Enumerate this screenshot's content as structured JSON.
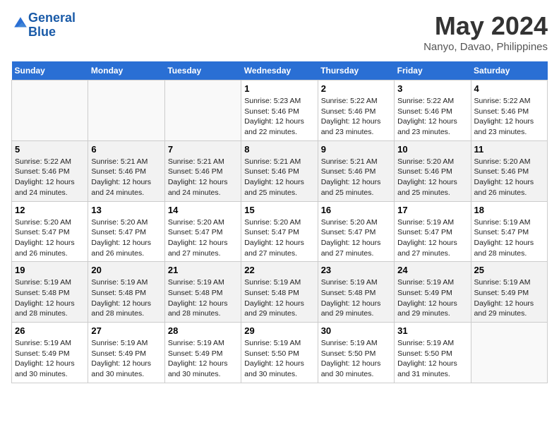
{
  "logo": {
    "line1": "General",
    "line2": "Blue",
    "alt": "GeneralBlue logo"
  },
  "title": "May 2024",
  "subtitle": "Nanyo, Davao, Philippines",
  "header": {
    "days": [
      "Sunday",
      "Monday",
      "Tuesday",
      "Wednesday",
      "Thursday",
      "Friday",
      "Saturday"
    ]
  },
  "weeks": [
    {
      "cells": [
        {
          "date": "",
          "info": ""
        },
        {
          "date": "",
          "info": ""
        },
        {
          "date": "",
          "info": ""
        },
        {
          "date": "1",
          "info": "Sunrise: 5:23 AM\nSunset: 5:46 PM\nDaylight: 12 hours\nand 22 minutes."
        },
        {
          "date": "2",
          "info": "Sunrise: 5:22 AM\nSunset: 5:46 PM\nDaylight: 12 hours\nand 23 minutes."
        },
        {
          "date": "3",
          "info": "Sunrise: 5:22 AM\nSunset: 5:46 PM\nDaylight: 12 hours\nand 23 minutes."
        },
        {
          "date": "4",
          "info": "Sunrise: 5:22 AM\nSunset: 5:46 PM\nDaylight: 12 hours\nand 23 minutes."
        }
      ]
    },
    {
      "cells": [
        {
          "date": "5",
          "info": "Sunrise: 5:22 AM\nSunset: 5:46 PM\nDaylight: 12 hours\nand 24 minutes."
        },
        {
          "date": "6",
          "info": "Sunrise: 5:21 AM\nSunset: 5:46 PM\nDaylight: 12 hours\nand 24 minutes."
        },
        {
          "date": "7",
          "info": "Sunrise: 5:21 AM\nSunset: 5:46 PM\nDaylight: 12 hours\nand 24 minutes."
        },
        {
          "date": "8",
          "info": "Sunrise: 5:21 AM\nSunset: 5:46 PM\nDaylight: 12 hours\nand 25 minutes."
        },
        {
          "date": "9",
          "info": "Sunrise: 5:21 AM\nSunset: 5:46 PM\nDaylight: 12 hours\nand 25 minutes."
        },
        {
          "date": "10",
          "info": "Sunrise: 5:20 AM\nSunset: 5:46 PM\nDaylight: 12 hours\nand 25 minutes."
        },
        {
          "date": "11",
          "info": "Sunrise: 5:20 AM\nSunset: 5:46 PM\nDaylight: 12 hours\nand 26 minutes."
        }
      ]
    },
    {
      "cells": [
        {
          "date": "12",
          "info": "Sunrise: 5:20 AM\nSunset: 5:47 PM\nDaylight: 12 hours\nand 26 minutes."
        },
        {
          "date": "13",
          "info": "Sunrise: 5:20 AM\nSunset: 5:47 PM\nDaylight: 12 hours\nand 26 minutes."
        },
        {
          "date": "14",
          "info": "Sunrise: 5:20 AM\nSunset: 5:47 PM\nDaylight: 12 hours\nand 27 minutes."
        },
        {
          "date": "15",
          "info": "Sunrise: 5:20 AM\nSunset: 5:47 PM\nDaylight: 12 hours\nand 27 minutes."
        },
        {
          "date": "16",
          "info": "Sunrise: 5:20 AM\nSunset: 5:47 PM\nDaylight: 12 hours\nand 27 minutes."
        },
        {
          "date": "17",
          "info": "Sunrise: 5:19 AM\nSunset: 5:47 PM\nDaylight: 12 hours\nand 27 minutes."
        },
        {
          "date": "18",
          "info": "Sunrise: 5:19 AM\nSunset: 5:47 PM\nDaylight: 12 hours\nand 28 minutes."
        }
      ]
    },
    {
      "cells": [
        {
          "date": "19",
          "info": "Sunrise: 5:19 AM\nSunset: 5:48 PM\nDaylight: 12 hours\nand 28 minutes."
        },
        {
          "date": "20",
          "info": "Sunrise: 5:19 AM\nSunset: 5:48 PM\nDaylight: 12 hours\nand 28 minutes."
        },
        {
          "date": "21",
          "info": "Sunrise: 5:19 AM\nSunset: 5:48 PM\nDaylight: 12 hours\nand 28 minutes."
        },
        {
          "date": "22",
          "info": "Sunrise: 5:19 AM\nSunset: 5:48 PM\nDaylight: 12 hours\nand 29 minutes."
        },
        {
          "date": "23",
          "info": "Sunrise: 5:19 AM\nSunset: 5:48 PM\nDaylight: 12 hours\nand 29 minutes."
        },
        {
          "date": "24",
          "info": "Sunrise: 5:19 AM\nSunset: 5:49 PM\nDaylight: 12 hours\nand 29 minutes."
        },
        {
          "date": "25",
          "info": "Sunrise: 5:19 AM\nSunset: 5:49 PM\nDaylight: 12 hours\nand 29 minutes."
        }
      ]
    },
    {
      "cells": [
        {
          "date": "26",
          "info": "Sunrise: 5:19 AM\nSunset: 5:49 PM\nDaylight: 12 hours\nand 30 minutes."
        },
        {
          "date": "27",
          "info": "Sunrise: 5:19 AM\nSunset: 5:49 PM\nDaylight: 12 hours\nand 30 minutes."
        },
        {
          "date": "28",
          "info": "Sunrise: 5:19 AM\nSunset: 5:49 PM\nDaylight: 12 hours\nand 30 minutes."
        },
        {
          "date": "29",
          "info": "Sunrise: 5:19 AM\nSunset: 5:50 PM\nDaylight: 12 hours\nand 30 minutes."
        },
        {
          "date": "30",
          "info": "Sunrise: 5:19 AM\nSunset: 5:50 PM\nDaylight: 12 hours\nand 30 minutes."
        },
        {
          "date": "31",
          "info": "Sunrise: 5:19 AM\nSunset: 5:50 PM\nDaylight: 12 hours\nand 31 minutes."
        },
        {
          "date": "",
          "info": ""
        }
      ]
    }
  ]
}
